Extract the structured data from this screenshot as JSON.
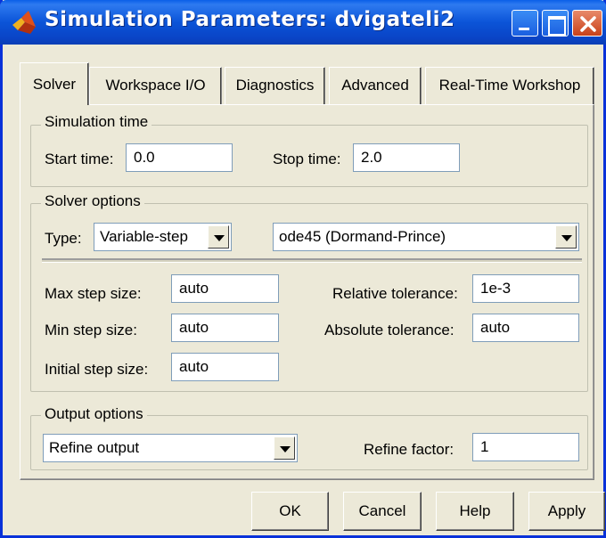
{
  "window": {
    "title": "Simulation Parameters: dvigateli2"
  },
  "tabs": [
    {
      "label": "Solver",
      "active": true
    },
    {
      "label": "Workspace I/O",
      "active": false
    },
    {
      "label": "Diagnostics",
      "active": false
    },
    {
      "label": "Advanced",
      "active": false
    },
    {
      "label": "Real-Time Workshop",
      "active": false
    }
  ],
  "simulation_time": {
    "legend": "Simulation time",
    "start_label": "Start time:",
    "start_value": "0.0",
    "stop_label": "Stop time:",
    "stop_value": "2.0"
  },
  "solver_options": {
    "legend": "Solver options",
    "type_label": "Type:",
    "type_value": "Variable-step",
    "solver_value": "ode45 (Dormand-Prince)",
    "max_step_label": "Max step size:",
    "max_step_value": "auto",
    "min_step_label": "Min step size:",
    "min_step_value": "auto",
    "initial_step_label": "Initial step size:",
    "initial_step_value": "auto",
    "rel_tol_label": "Relative tolerance:",
    "rel_tol_value": "1e-3",
    "abs_tol_label": "Absolute tolerance:",
    "abs_tol_value": "auto"
  },
  "output_options": {
    "legend": "Output options",
    "mode_value": "Refine output",
    "refine_label": "Refine factor:",
    "refine_value": "1"
  },
  "buttons": {
    "ok": "OK",
    "cancel": "Cancel",
    "help": "Help",
    "apply": "Apply"
  },
  "colors": {
    "titlebar": "#0a4fd8",
    "dialog_bg": "#ece9d8",
    "field_border": "#7f9db9",
    "close_button": "#c9411a"
  },
  "icons": [
    "matlab-icon",
    "minimize-icon",
    "maximize-icon",
    "close-icon",
    "dropdown-arrow-icon"
  ]
}
